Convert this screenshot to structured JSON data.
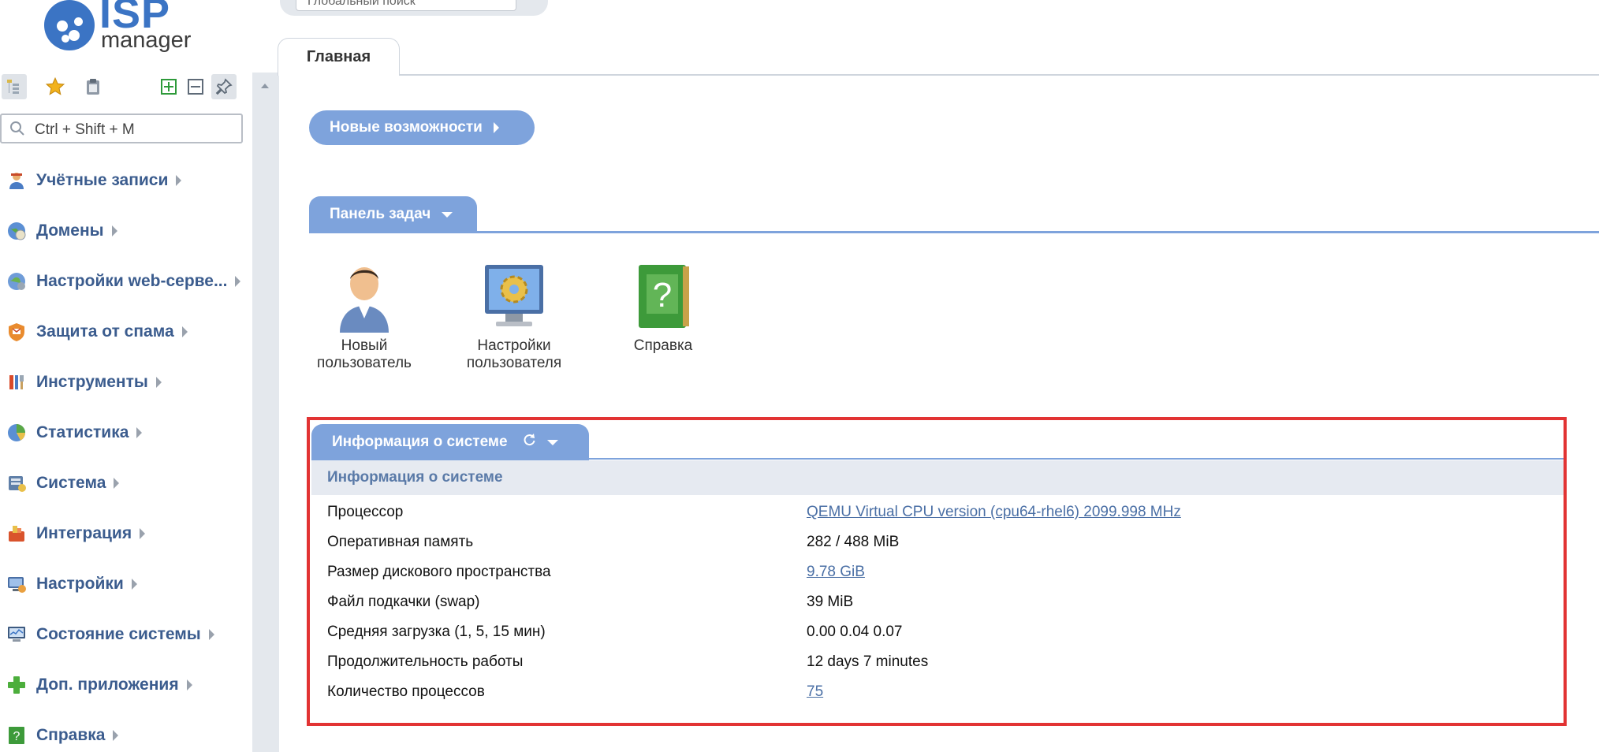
{
  "app": {
    "logo_text": "ISP",
    "logo_subtext": "manager"
  },
  "top_search": {
    "placeholder": "Глобальный поиск"
  },
  "tabs": [
    {
      "label": "Главная",
      "active": true
    }
  ],
  "sidebar": {
    "toolbar": {
      "icons": [
        "tree-view-icon",
        "star-icon",
        "clipboard-icon",
        "expand-all-icon",
        "collapse-all-icon",
        "pin-icon"
      ]
    },
    "search": {
      "placeholder": "Ctrl + Shift + M"
    },
    "items": [
      {
        "label": "Учётные записи",
        "icon": "users-icon"
      },
      {
        "label": "Домены",
        "icon": "domains-icon"
      },
      {
        "label": "Настройки web-серве...",
        "icon": "web-server-icon"
      },
      {
        "label": "Защита от спама",
        "icon": "spam-protection-icon"
      },
      {
        "label": "Инструменты",
        "icon": "tools-icon"
      },
      {
        "label": "Статистика",
        "icon": "statistics-icon"
      },
      {
        "label": "Система",
        "icon": "system-icon"
      },
      {
        "label": "Интеграция",
        "icon": "integration-icon"
      },
      {
        "label": "Настройки",
        "icon": "settings-icon"
      },
      {
        "label": "Состояние системы",
        "icon": "system-status-icon"
      },
      {
        "label": "Доп. приложения",
        "icon": "add-apps-icon"
      },
      {
        "label": "Справка",
        "icon": "help-icon"
      }
    ]
  },
  "main": {
    "new_features_label": "Новые возможности",
    "taskbar": {
      "title": "Панель задач",
      "tasks": [
        {
          "label_line1": "Новый",
          "label_line2": "пользователь",
          "icon": "new-user-icon"
        },
        {
          "label_line1": "Настройки",
          "label_line2": "пользователя",
          "icon": "user-settings-icon"
        },
        {
          "label_line1": "Справка",
          "label_line2": "",
          "icon": "help-book-icon"
        }
      ]
    },
    "sysinfo": {
      "tab_title": "Информация о системе",
      "header": "Информация о системе",
      "rows": [
        {
          "label": "Процессор",
          "value": "QEMU Virtual CPU version (cpu64-rhel6) 2099.998 MHz",
          "link": true
        },
        {
          "label": "Оперативная память",
          "value": "282 / 488 MiB",
          "link": false
        },
        {
          "label": "Размер дискового пространства",
          "value": "9.78 GiB",
          "link": true
        },
        {
          "label": "Файл подкачки (swap)",
          "value": "39 MiB",
          "link": false
        },
        {
          "label": "Средняя загрузка (1, 5, 15 мин)",
          "value": "0.00 0.04 0.07",
          "link": false
        },
        {
          "label": "Продолжительность работы",
          "value": "12 days 7 minutes",
          "link": false
        },
        {
          "label": "Количество процессов",
          "value": "75",
          "link": true
        }
      ]
    }
  },
  "colors": {
    "accent": "#7ea3dc",
    "menu_text": "#3b5c8e",
    "link": "#4a6fa5",
    "highlight_border": "#e23333"
  }
}
